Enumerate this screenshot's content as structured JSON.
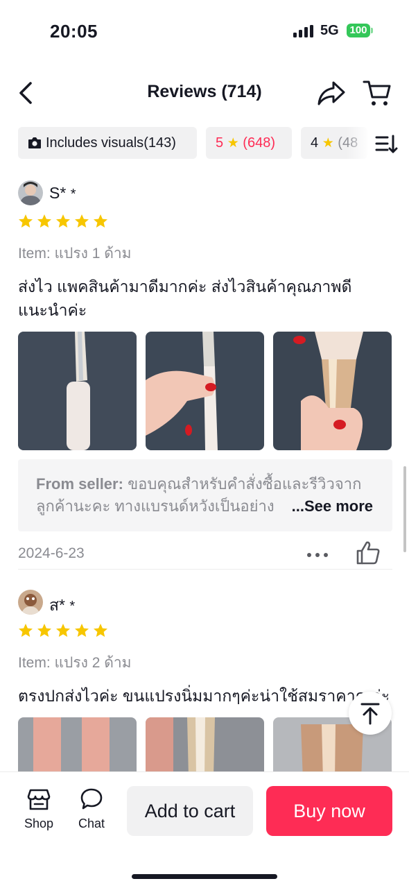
{
  "status_bar": {
    "time": "20:05",
    "network": "5G",
    "battery": "100"
  },
  "nav": {
    "title": "Reviews (714)"
  },
  "filters": {
    "visuals": {
      "label": "Includes visuals",
      "count": "(143)"
    },
    "five_star": {
      "rating": "5",
      "count": "(648)"
    },
    "four_star": {
      "rating": "4",
      "count": "(48"
    }
  },
  "reviews": [
    {
      "name": "S*",
      "name_suffix": "*",
      "stars": 5,
      "item": "Item: แปรง 1 ด้าม",
      "text": "ส่งไว แพคสินค้ามาดีมากค่ะ ส่งไวสินค้าคุณภาพดี แนะนำค่ะ",
      "seller_label": "From seller:",
      "seller_text": "ขอบคุณสำหรับคำสั่งซื้อและรีวิวจากลูกค้านะคะ ทางแบรนด์หวังเป็นอย่าง",
      "see_more": "...See more",
      "date": "2024-6-23"
    },
    {
      "name": "ส*",
      "name_suffix": "*",
      "stars": 5,
      "item": "Item: แปรง 2 ด้าม",
      "text": "ตรงปกส่งไวค่ะ ขนแปรงนิ่มมากๆค่ะน่าใช้สมราคาค ค่ะ"
    }
  ],
  "bottom_bar": {
    "shop": "Shop",
    "chat": "Chat",
    "add_to_cart": "Add to cart",
    "buy_now": "Buy now"
  },
  "colors": {
    "accent": "#fe2c55",
    "star": "#f7c600",
    "muted": "#8a8b91"
  },
  "icons": [
    "back-icon",
    "share-icon",
    "cart-icon",
    "camera-icon",
    "sort-icon",
    "star-icon",
    "more-icon",
    "thumbs-up-icon",
    "arrow-up-icon",
    "shop-icon",
    "chat-icon"
  ]
}
